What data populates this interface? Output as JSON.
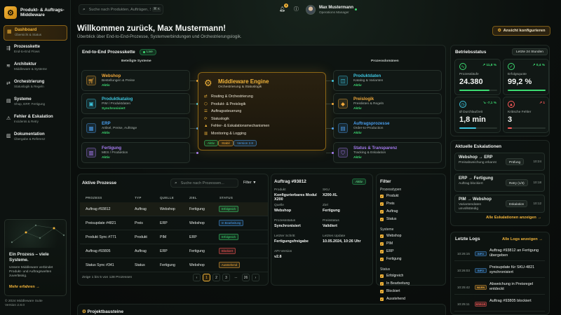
{
  "brand": {
    "name": "Produkt- & Auftrags-Middleware",
    "logo_icon": "gear-icon"
  },
  "nav": [
    {
      "title": "Dashboard",
      "sub": "Übersicht & Status",
      "icon": "grid-icon",
      "active": true
    },
    {
      "title": "Prozesskette",
      "sub": "End-to-End Flows",
      "icon": "flow-icon",
      "active": false
    },
    {
      "title": "Architektur",
      "sub": "Middleware & Systeme",
      "icon": "layers-icon",
      "active": false
    },
    {
      "title": "Orchestrierung",
      "sub": "Statuslogik & Regeln",
      "icon": "route-icon",
      "active": false
    },
    {
      "title": "Systeme",
      "sub": "Shop, ERP, Fertigung",
      "icon": "server-icon",
      "active": false
    },
    {
      "title": "Fehler & Eskalation",
      "sub": "Incidents & Retry",
      "icon": "warning-icon",
      "active": false
    },
    {
      "title": "Dokumentation",
      "sub": "Übergabe & Referenz",
      "icon": "document-icon",
      "active": false
    }
  ],
  "promo": {
    "title": "Ein Prozess – viele Systeme.",
    "text": "Unsere Middleware verbindet Produkt- und Auftragswelten zuverlässig.",
    "link": "Mehr erfahren →"
  },
  "copyright": {
    "line1": "© 2024 Middleware Suite",
    "line2": "Version 2.8.0"
  },
  "search": {
    "placeholder": "Suche nach Produkten, Aufträgen, Systemen...",
    "shortcut": "⌘ K"
  },
  "topbar": {
    "notifications": "3"
  },
  "user": {
    "name": "Max Mustermann",
    "role": "Operations Manager"
  },
  "welcome": {
    "title": "Willkommen zurück, Max Mustermann!",
    "subtitle": "Überblick über End-to-End-Prozesse, Systemverbindungen und Orchestrierungslogik.",
    "config_button": "Ansicht konfigurieren"
  },
  "chain": {
    "title": "End-to-End Prozesskette",
    "live": "Live",
    "left_header": "Beteiligte Systeme",
    "right_header": "Prozessdomänen",
    "left": [
      {
        "title": "Webshop",
        "sub": "Bestellungen & Preise",
        "status": "Aktiv",
        "color": "#f2a93a",
        "icon": "cart-icon"
      },
      {
        "title": "Produktkatalog",
        "sub": "PIM / Produktdaten",
        "status": "Synchronisiert",
        "color": "#3ec6e0",
        "icon": "catalog-icon"
      },
      {
        "title": "ERP",
        "sub": "Artikel, Preise, Aufträge",
        "status": "Aktiv",
        "color": "#4a9ff0",
        "icon": "erp-icon"
      },
      {
        "title": "Fertigung",
        "sub": "MES / Produktion",
        "status": "Aktiv",
        "color": "#a77cf2",
        "icon": "factory-icon"
      }
    ],
    "right": [
      {
        "title": "Produktdaten",
        "sub": "Katalog & Varianten",
        "status": "Aktiv",
        "color": "#3ec6e0",
        "icon": "box-icon"
      },
      {
        "title": "Preislogik",
        "sub": "Preislisten & Regeln",
        "status": "Aktiv",
        "color": "#f2a93a",
        "icon": "tag-icon"
      },
      {
        "title": "Auftragsprozesse",
        "sub": "Order-to-Production",
        "status": "Aktiv",
        "color": "#4a9ff0",
        "icon": "order-icon"
      },
      {
        "title": "Status & Transparenz",
        "sub": "Tracking & Eskalation",
        "status": "Aktiv",
        "color": "#a77cf2",
        "icon": "shield-icon"
      }
    ],
    "middleware": {
      "title": "Middleware Engine",
      "sub": "Orchestrierung & Statuslogik",
      "items": [
        "Routing & Orchestrierung",
        "Produkt- & Preislogik",
        "Auftragssteuerung",
        "Statuslogik",
        "Fehler- & Eskalationsmechanismen",
        "Monitoring & Logging"
      ],
      "tags": [
        "Aktiv",
        "Stabil",
        "Version 2.8"
      ]
    }
  },
  "status": {
    "title": "Betriebsstatus",
    "range": "Letzte 24 Stunden",
    "metrics": [
      {
        "label": "Prozessläufe",
        "value": "24.380",
        "delta": "↗ 11,8 %",
        "delta_color": "#3ddc72",
        "icon": "pulse-icon",
        "color": "#3ddc72",
        "bar": 0.8
      },
      {
        "label": "Erfolgsquote",
        "value": "99,2 %",
        "delta": "↗ 0,4 %",
        "delta_color": "#3ddc72",
        "icon": "check-icon",
        "color": "#3ddc72",
        "bar": 0.992
      },
      {
        "label": "Ø Durchlaufzeit",
        "value": "1,8 min",
        "delta": "↘ -7,1 %",
        "delta_color": "#3ddc72",
        "icon": "clock-icon",
        "color": "#3ec6e0",
        "bar": 0.45
      },
      {
        "label": "Kritische Fehler",
        "value": "3",
        "delta": "↗ 1",
        "delta_color": "#ff5a5a",
        "icon": "alert-icon",
        "color": "#ff5a5a",
        "bar": 0.12
      }
    ]
  },
  "escalations": {
    "title": "Aktuelle Eskalationen",
    "items": [
      {
        "title": "Webshop → ERP",
        "sub": "Preisabweichung erkannt",
        "chip": "Prüfung",
        "time": "10:24"
      },
      {
        "title": "ERP → Fertigung",
        "sub": "Auftrag blockiert",
        "chip": "Retry (1/3)",
        "time": "10:18"
      },
      {
        "title": "PIM → Webshop",
        "sub": "Variantendaten unvollständig",
        "chip": "Eskalation",
        "time": "10:12"
      }
    ],
    "link": "Alle Eskalationen anzeigen →"
  },
  "logs": {
    "title": "Letzte Logs",
    "link": "Alle Logs anzeigen →",
    "items": [
      {
        "time": "10:26:15",
        "level": "INFO",
        "level_color": "#4a9ff0",
        "msg": "Auftrag #93812 an Fertigung übergeben"
      },
      {
        "time": "10:26:03",
        "level": "INFO",
        "level_color": "#4a9ff0",
        "msg": "Preisupdate für SKU-4821 synchronisiert"
      },
      {
        "time": "10:25:42",
        "level": "WARN",
        "level_color": "#f2a93a",
        "msg": "Abweichung in Preisregel entdeckt"
      },
      {
        "time": "10:25:11",
        "level": "ERROR",
        "level_color": "#ff5a5a",
        "msg": "Auftrag #93805 blockiert"
      }
    ]
  },
  "processes": {
    "title": "Aktive Prozesse",
    "search_placeholder": "Suche nach Prozessen...",
    "filter": "Filter",
    "headers": [
      "PROZESS",
      "TYP",
      "QUELLE",
      "ZIEL",
      "STATUS"
    ],
    "rows": [
      {
        "name": "Auftrag #93812",
        "type": "Auftrag",
        "source": "Webshop",
        "target": "Fertigung",
        "status": "Erfolgreich",
        "color": "#3ddc72"
      },
      {
        "name": "Preisupdate #4821",
        "type": "Preis",
        "source": "ERP",
        "target": "Webshop",
        "status": "In Bearbeitung",
        "color": "#4a9ff0"
      },
      {
        "name": "Produkt Sync #771",
        "type": "Produkt",
        "source": "PIM",
        "target": "ERP",
        "status": "Erfolgreich",
        "color": "#3ddc72"
      },
      {
        "name": "Auftrag #93805",
        "type": "Auftrag",
        "source": "ERP",
        "target": "Fertigung",
        "status": "Blockiert",
        "color": "#ff5a5a"
      },
      {
        "name": "Status Sync #341",
        "type": "Status",
        "source": "Fertigung",
        "target": "Webshop",
        "status": "Ausstehend",
        "color": "#f2a93a"
      }
    ],
    "footer": "Zeige 1 bis 5 von 128 Prozessen",
    "pages": [
      "‹",
      "1",
      "2",
      "3",
      "...",
      "26",
      "›"
    ]
  },
  "detail": {
    "title": "Auftrag #93812",
    "badge": "Aktiv",
    "fields": [
      {
        "label": "Produkt",
        "value": "Konfigurierbares Modul X200"
      },
      {
        "label": "SKU",
        "value": "X200-XL"
      },
      {
        "label": "Quelle",
        "value": "Webshop"
      },
      {
        "label": "Ziel",
        "value": "Fertigung"
      },
      {
        "label": "Prozessstatus",
        "value": "Synchronisiert"
      },
      {
        "label": "Preisstatus",
        "value": "Validiert"
      },
      {
        "label": "Letzter Schritt",
        "value": "Fertigungsfreigabe"
      },
      {
        "label": "Letztes Update",
        "value": "10.05.2024, 10:26 Uhr"
      },
      {
        "label": "API-Version",
        "value": "v2.8"
      }
    ]
  },
  "filter": {
    "title": "Filter",
    "sections": [
      {
        "title": "Prozesstypen",
        "items": [
          "Produkt",
          "Preis",
          "Auftrag",
          "Status"
        ]
      },
      {
        "title": "Systeme",
        "items": [
          "Webshop",
          "PIM",
          "ERP",
          "Fertigung"
        ]
      },
      {
        "title": "Status",
        "items": [
          "Erfolgreich",
          "In Bearbeitung",
          "Blockiert",
          "Ausstehend"
        ]
      }
    ]
  },
  "blocks": {
    "title": "Projektbausteine"
  }
}
